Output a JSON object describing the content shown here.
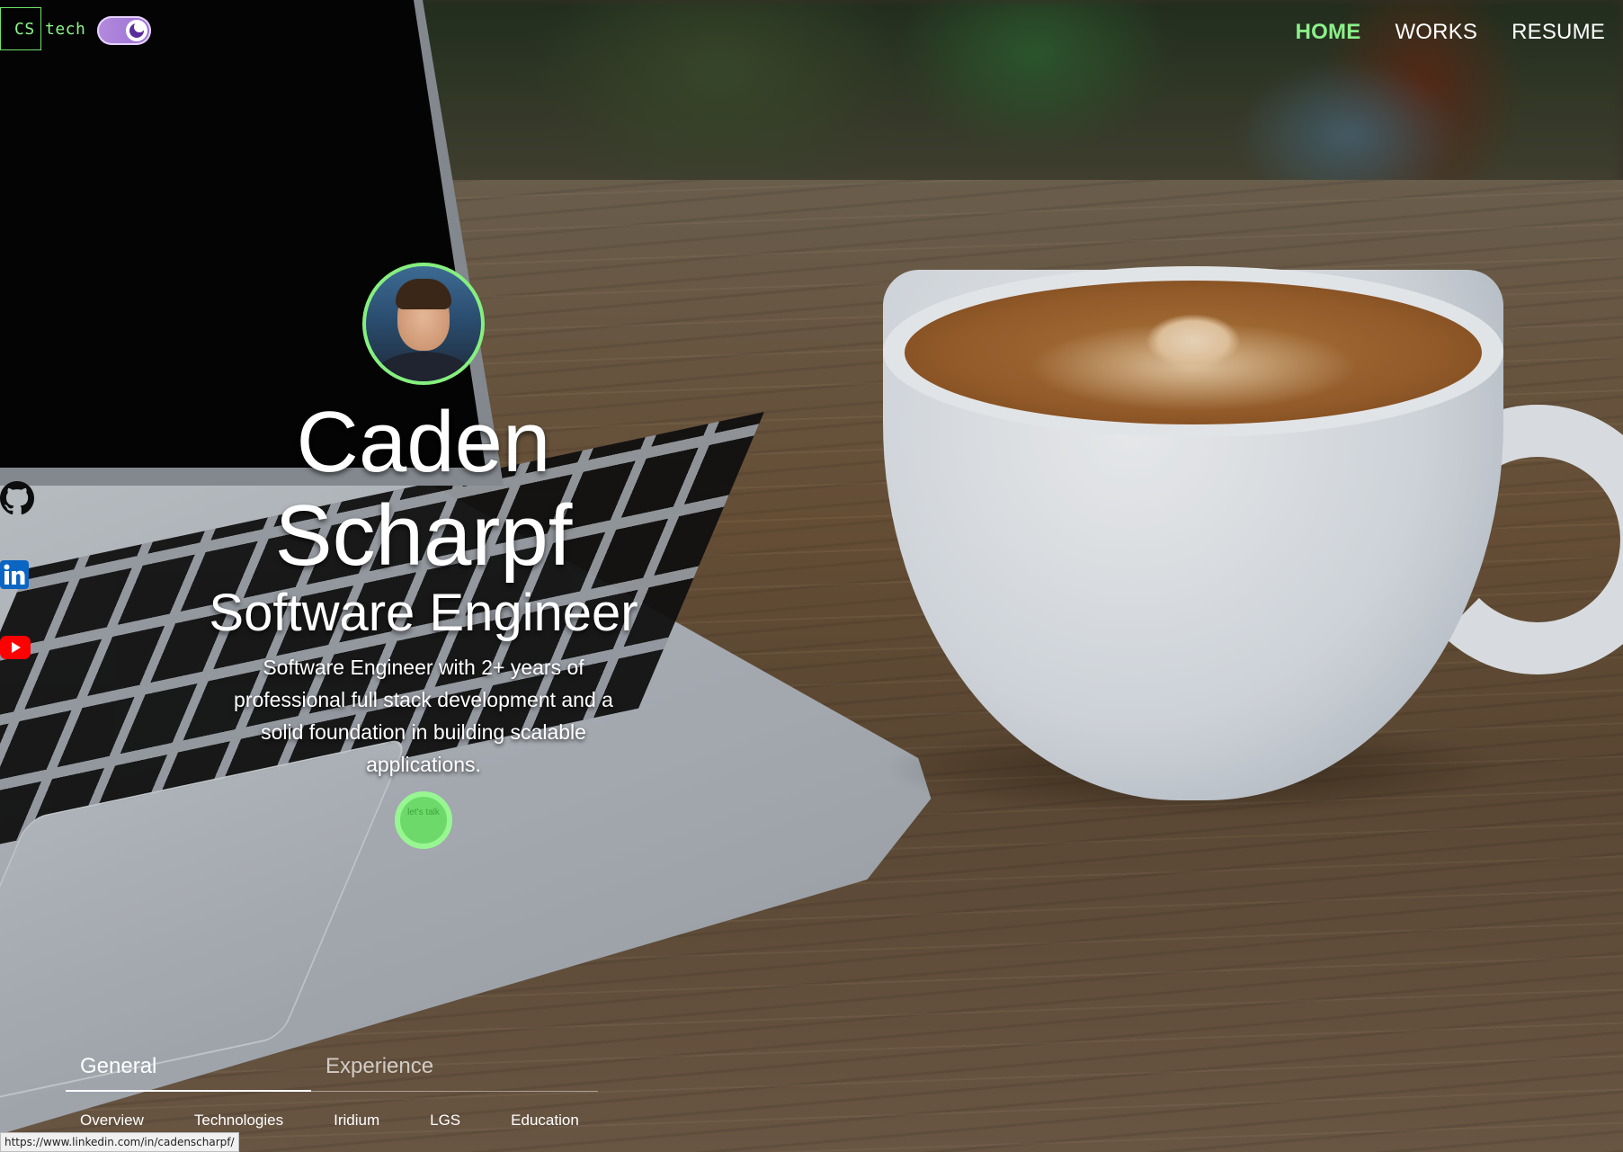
{
  "header": {
    "logo_text": "CS tech",
    "nav": [
      {
        "label": "HOME",
        "active": true
      },
      {
        "label": "WORKS",
        "active": false
      },
      {
        "label": "RESUME",
        "active": false
      }
    ]
  },
  "social": [
    {
      "icon": "github-icon"
    },
    {
      "icon": "linkedin-icon"
    },
    {
      "icon": "youtube-icon"
    }
  ],
  "hero": {
    "first_name": "Caden",
    "last_name": "Scharpf",
    "role": "Software Engineer",
    "description": "Software Engineer with 2+ years of professional full stack development and a solid foundation in building scalable applications.",
    "cta_label": "let's talk"
  },
  "tabs": {
    "items": [
      {
        "label": "General",
        "active": true
      },
      {
        "label": "Experience",
        "active": false
      }
    ],
    "subtabs": [
      "Overview",
      "Technologies",
      "Iridium",
      "LGS",
      "Education"
    ]
  },
  "status_url": "https://www.linkedin.com/in/cadenscharpf/",
  "colors": {
    "accent": "#86ef7f",
    "toggle": "#9c6fd6",
    "linkedin": "#0a66c2",
    "youtube": "#ff0000"
  }
}
